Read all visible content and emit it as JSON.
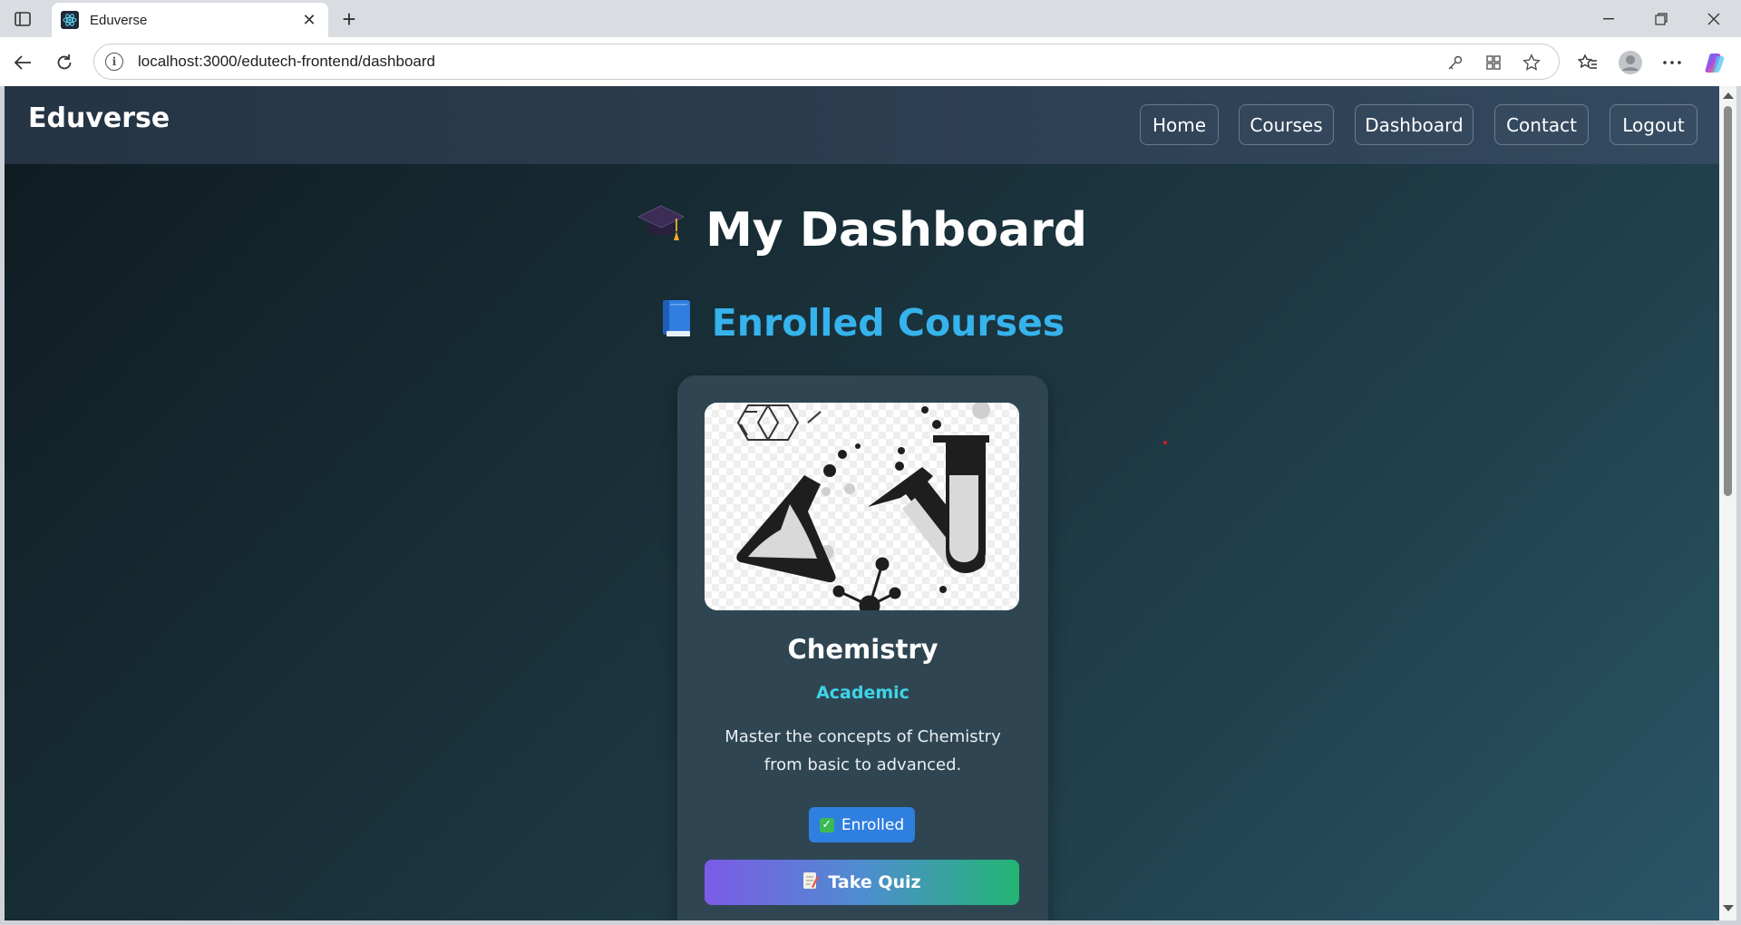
{
  "browser": {
    "tab_title": "Eduverse",
    "tab_favicon": "react-icon",
    "url": "localhost:3000/edutech-frontend/dashboard"
  },
  "navbar": {
    "brand": "Eduverse",
    "links": [
      {
        "label": "Home"
      },
      {
        "label": "Courses"
      },
      {
        "label": "Dashboard"
      },
      {
        "label": "Contact"
      },
      {
        "label": "Logout"
      }
    ]
  },
  "dashboard": {
    "title": "My Dashboard",
    "title_icon": "graduation-cap-icon",
    "section_title": "Enrolled Courses",
    "section_icon": "blue-book-icon",
    "courses": [
      {
        "name": "Chemistry",
        "category": "Academic",
        "description": "Master the concepts of Chemistry from basic to advanced.",
        "status": "Enrolled",
        "action": "Take Quiz",
        "image": "chemistry-illustration"
      }
    ]
  },
  "colors": {
    "accent_blue": "#36b3ec",
    "category_cyan": "#3fd4e8",
    "badge_blue": "#2f7fe0"
  }
}
